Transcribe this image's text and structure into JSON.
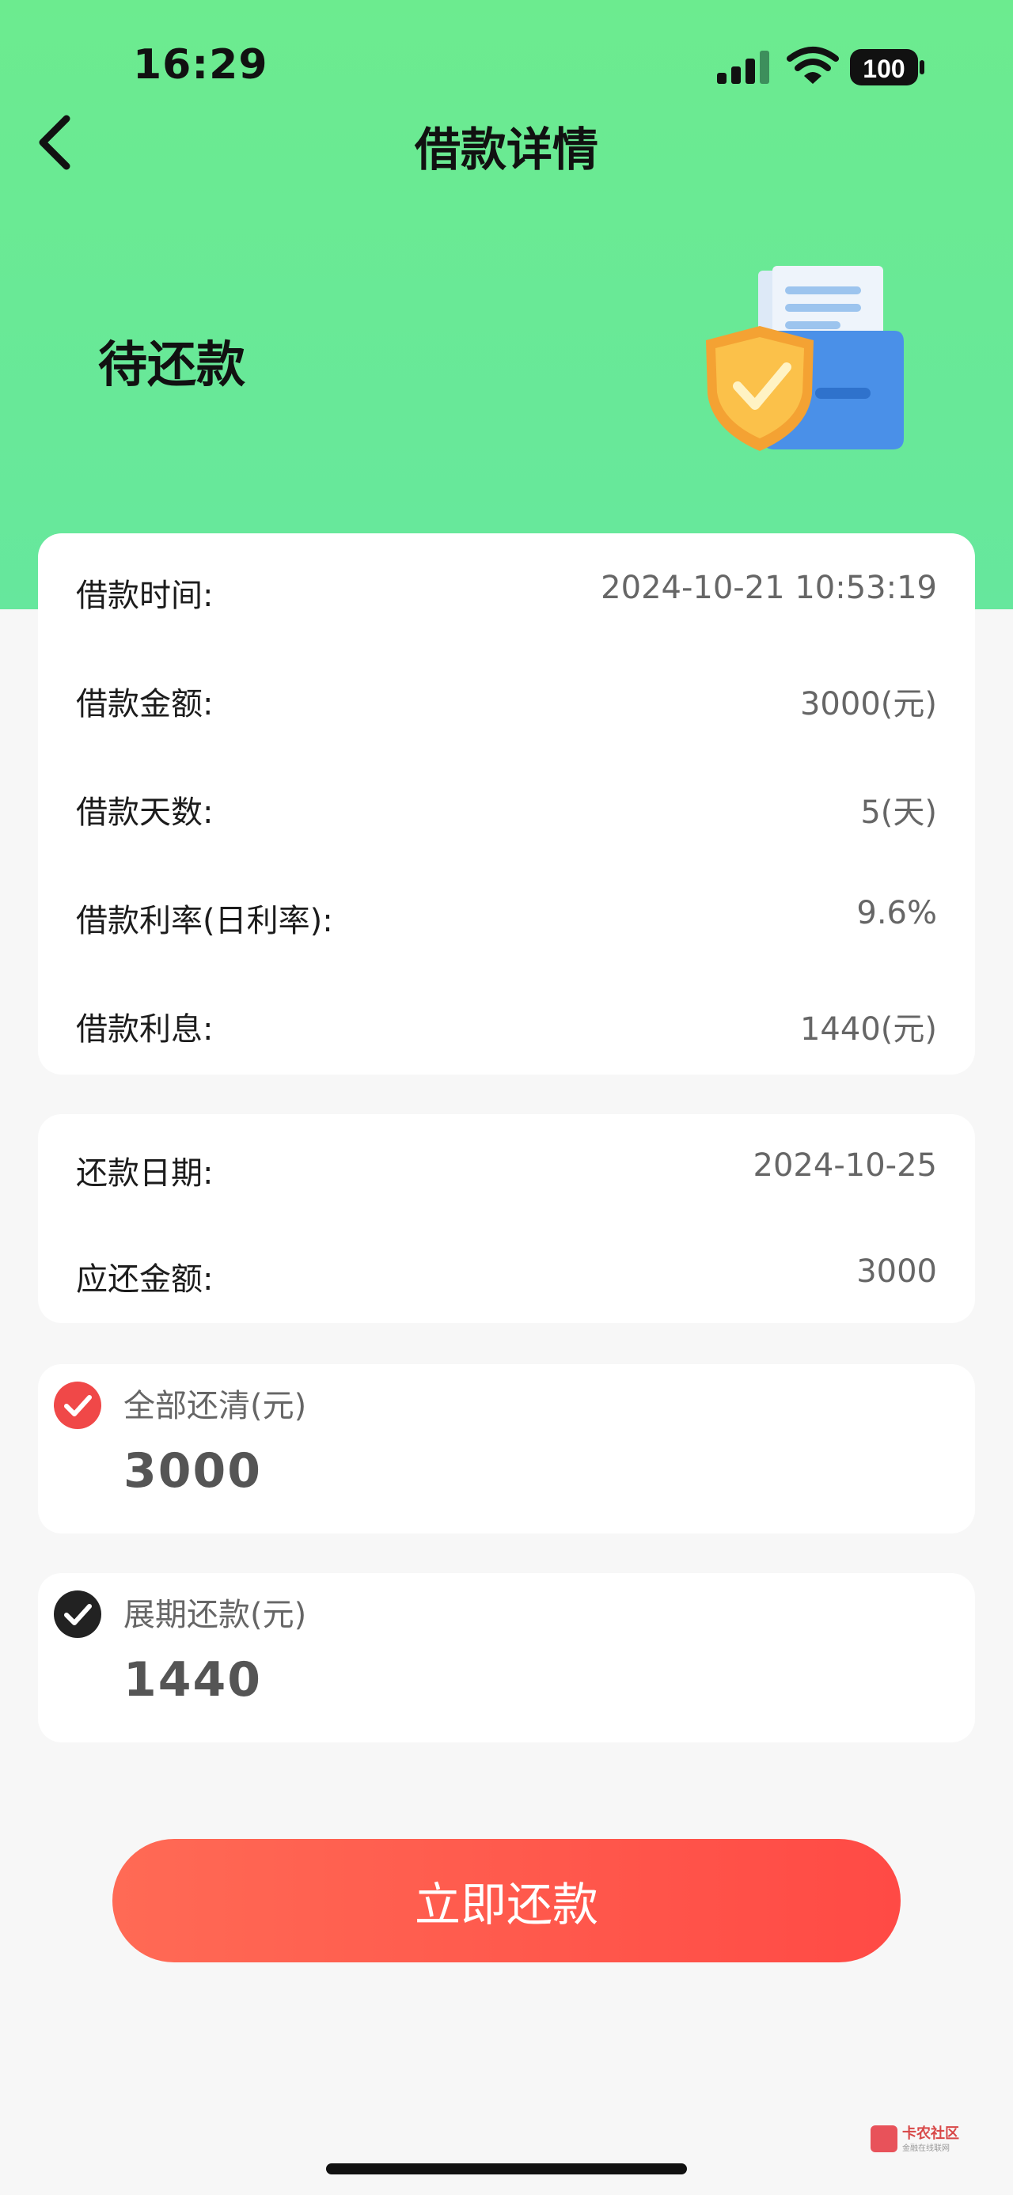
{
  "status_bar": {
    "time": "16:29",
    "battery": "100",
    "icons": [
      "signal-icon",
      "wifi-icon",
      "battery-icon"
    ]
  },
  "nav": {
    "title": "借款详情",
    "back_icon": "chevron-left-icon"
  },
  "hero": {
    "status": "待还款",
    "illustration_icon": "shield-folder-icon"
  },
  "loan_details": [
    {
      "label": "借款时间:",
      "value": "2024-10-21 10:53:19"
    },
    {
      "label": "借款金额:",
      "value": "3000(元)"
    },
    {
      "label": "借款天数:",
      "value": "5(天)"
    },
    {
      "label": "借款利率(日利率):",
      "value": "9.6%"
    },
    {
      "label": "借款利息:",
      "value": "1440(元)"
    }
  ],
  "repayment": [
    {
      "label": "还款日期:",
      "value": "2024-10-25"
    },
    {
      "label": "应还金额:",
      "value": "3000"
    }
  ],
  "options": {
    "full": {
      "label": "全部还清(元)",
      "amount": "3000",
      "selected": true
    },
    "extension": {
      "label": "展期还款(元)",
      "amount": "1440",
      "selected": false
    }
  },
  "actions": {
    "pay_now": "立即还款"
  },
  "watermark": {
    "name": "卡农社区",
    "sub": "金融在线联网"
  },
  "colors": {
    "header_green": "#6ceb8f",
    "accent_red": "#ff4a45",
    "check_selected": "#f04848",
    "check_dark": "#222222"
  }
}
